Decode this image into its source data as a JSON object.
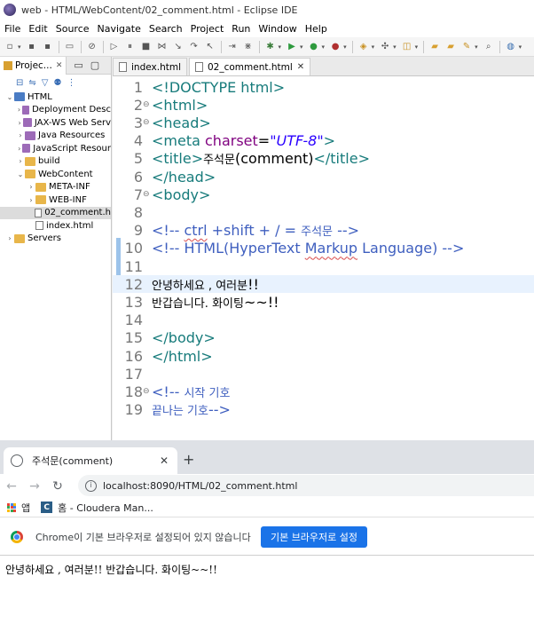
{
  "eclipse": {
    "title": "web - HTML/WebContent/02_comment.html - Eclipse IDE",
    "menus": [
      "File",
      "Edit",
      "Source",
      "Navigate",
      "Search",
      "Project",
      "Run",
      "Window",
      "Help"
    ],
    "explorer": {
      "tab_label": "Projec...",
      "tree": [
        {
          "label": "HTML",
          "indent": 0,
          "expanded": true,
          "icon": "project-icon"
        },
        {
          "label": "Deployment Desc",
          "indent": 1,
          "expanded": false,
          "icon": "deployment-icon"
        },
        {
          "label": "JAX-WS Web Serv",
          "indent": 1,
          "expanded": false,
          "icon": "webservice-icon"
        },
        {
          "label": "Java Resources",
          "indent": 1,
          "expanded": false,
          "icon": "library-icon"
        },
        {
          "label": "JavaScript Resour",
          "indent": 1,
          "expanded": false,
          "icon": "library-icon"
        },
        {
          "label": "build",
          "indent": 1,
          "expanded": false,
          "icon": "folder-icon"
        },
        {
          "label": "WebContent",
          "indent": 1,
          "expanded": true,
          "icon": "folder-icon"
        },
        {
          "label": "META-INF",
          "indent": 2,
          "expanded": false,
          "icon": "folder-icon"
        },
        {
          "label": "WEB-INF",
          "indent": 2,
          "expanded": false,
          "icon": "folder-icon"
        },
        {
          "label": "02_comment.h",
          "indent": 2,
          "expanded": null,
          "icon": "file-icon",
          "selected": true
        },
        {
          "label": "index.html",
          "indent": 2,
          "expanded": null,
          "icon": "file-icon"
        },
        {
          "label": "Servers",
          "indent": 0,
          "expanded": false,
          "icon": "folder-icon"
        }
      ]
    },
    "editor_tabs": [
      {
        "label": "index.html",
        "active": false
      },
      {
        "label": "02_comment.html",
        "active": true
      }
    ],
    "code_lines": [
      {
        "n": "1",
        "parts": [
          [
            "tag",
            "<!DOCTYPE html>"
          ]
        ]
      },
      {
        "n": "2",
        "fold": "⊖",
        "parts": [
          [
            "tag",
            "<html>"
          ]
        ]
      },
      {
        "n": "3",
        "fold": "⊖",
        "parts": [
          [
            "tag",
            "<head>"
          ]
        ]
      },
      {
        "n": "4",
        "parts": [
          [
            "tag",
            "<meta "
          ],
          [
            "attr",
            "charset"
          ],
          [
            "txt",
            "="
          ],
          [
            "val",
            "\"UTF-8\""
          ],
          [
            "tag",
            ">"
          ]
        ]
      },
      {
        "n": "5",
        "parts": [
          [
            "tag",
            "<title>"
          ],
          [
            "txtsm",
            "주석문"
          ],
          [
            "txt",
            "(comment)"
          ],
          [
            "tag",
            "</title>"
          ]
        ]
      },
      {
        "n": "6",
        "parts": [
          [
            "tag",
            "</head>"
          ]
        ]
      },
      {
        "n": "7",
        "fold": "⊖",
        "parts": [
          [
            "tag",
            "<body>"
          ]
        ]
      },
      {
        "n": "8",
        "parts": []
      },
      {
        "n": "9",
        "parts": [
          [
            "com",
            "<!-- "
          ],
          [
            "comsq",
            "ctrl"
          ],
          [
            "com",
            " +shift + / = "
          ],
          [
            "comsm",
            "주석문"
          ],
          [
            "com",
            " -->"
          ]
        ]
      },
      {
        "n": "10",
        "parts": [
          [
            "com",
            "<!-- HTML(HyperText "
          ],
          [
            "comsq",
            "Markup"
          ],
          [
            "com",
            " Language)  -->"
          ]
        ]
      },
      {
        "n": "11",
        "parts": []
      },
      {
        "n": "12",
        "hl": true,
        "parts": [
          [
            "txtsm",
            "안녕하세요 , 여러분"
          ],
          [
            "txt",
            "!!"
          ]
        ]
      },
      {
        "n": "13",
        "parts": [
          [
            "txtsm",
            "반갑습니다. 화이팅"
          ],
          [
            "txt",
            "~~!!"
          ]
        ]
      },
      {
        "n": "14",
        "parts": []
      },
      {
        "n": "15",
        "parts": [
          [
            "tag",
            "</body>"
          ]
        ]
      },
      {
        "n": "16",
        "parts": [
          [
            "tag",
            "</html>"
          ]
        ]
      },
      {
        "n": "17",
        "parts": []
      },
      {
        "n": "18",
        "fold": "⊖",
        "parts": [
          [
            "com",
            "<!-- "
          ],
          [
            "comsm",
            "시작 기호"
          ]
        ]
      },
      {
        "n": "19",
        "parts": [
          [
            "comsm",
            "끝나는 기호"
          ],
          [
            "com",
            "-->"
          ]
        ]
      }
    ]
  },
  "browser": {
    "tab_title": "주석문(comment)",
    "url": "localhost:8090/HTML/02_comment.html",
    "bookmarks": {
      "apps": "앱",
      "home": "홈 - Cloudera Man..."
    },
    "infobar": {
      "message": "Chrome이 기본 브라우저로 설정되어 있지 않습니다",
      "button": "기본 브라우저로 설정"
    },
    "page_text": "안녕하세요 , 여러분!! 반갑습니다. 화이팅~~!!"
  }
}
